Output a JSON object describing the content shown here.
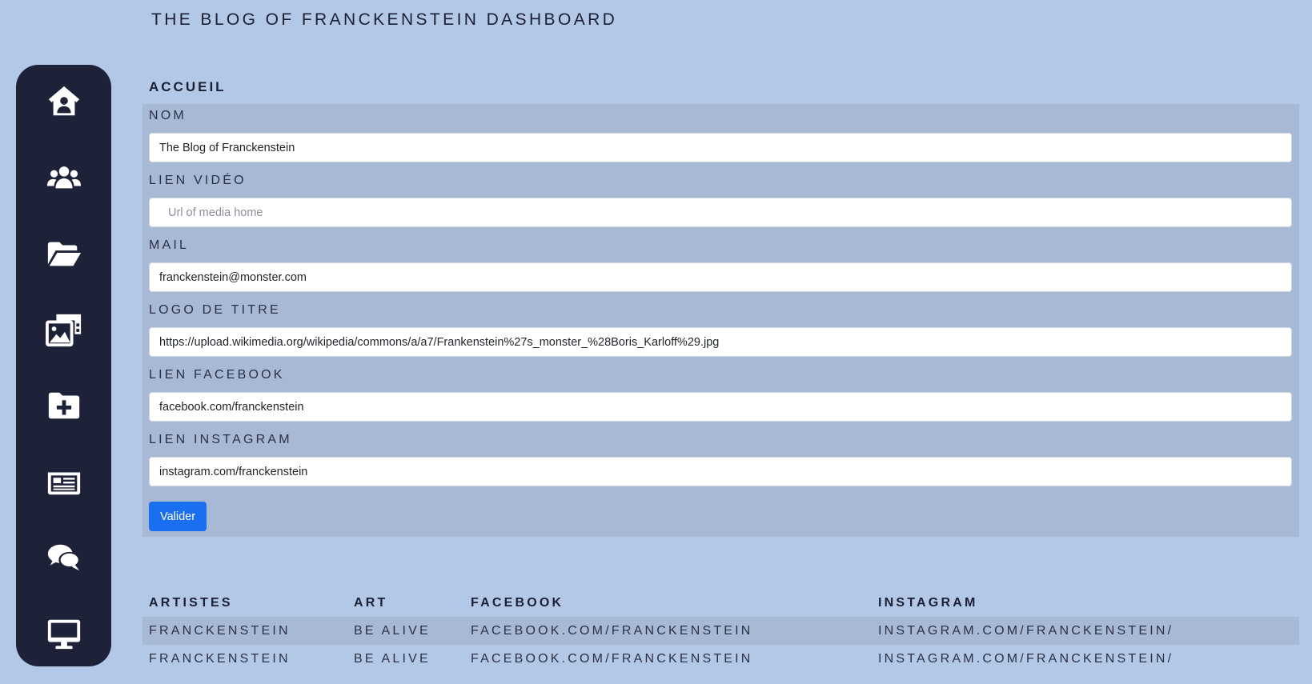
{
  "app": {
    "title": "THE BLOG OF FRANCKENSTEIN DASHBOARD"
  },
  "sidebar": {
    "items": [
      {
        "icon": "home-user-icon"
      },
      {
        "icon": "users-icon"
      },
      {
        "icon": "folder-open-icon"
      },
      {
        "icon": "photo-video-icon"
      },
      {
        "icon": "folder-plus-icon"
      },
      {
        "icon": "newspaper-icon"
      },
      {
        "icon": "comments-icon"
      },
      {
        "icon": "desktop-icon"
      }
    ]
  },
  "form": {
    "section_title": "ACCUEIL",
    "fields": {
      "nom": {
        "label": "NOM",
        "value": "The Blog of Franckenstein",
        "placeholder": ""
      },
      "lien_video": {
        "label": "LIEN VIDÉO",
        "value": "",
        "placeholder": "Url of media home"
      },
      "mail": {
        "label": "MAIL",
        "value": "franckenstein@monster.com",
        "placeholder": ""
      },
      "logo_titre": {
        "label": "LOGO DE TITRE",
        "value": "https://upload.wikimedia.org/wikipedia/commons/a/a7/Frankenstein%27s_monster_%28Boris_Karloff%29.jpg",
        "placeholder": ""
      },
      "lien_facebook": {
        "label": "LIEN FACEBOOK",
        "value": "facebook.com/franckenstein",
        "placeholder": ""
      },
      "lien_instagram": {
        "label": "LIEN INSTAGRAM",
        "value": "instagram.com/franckenstein",
        "placeholder": ""
      }
    },
    "submit_label": "Valider"
  },
  "table": {
    "headers": [
      "ARTISTES",
      "ART",
      "FACEBOOK",
      "INSTAGRAM"
    ],
    "rows": [
      [
        "FRANCKENSTEIN",
        "BE ALIVE",
        "FACEBOOK.COM/FRANCKENSTEIN",
        "INSTAGRAM.COM/FRANCKENSTEIN/"
      ],
      [
        "FRANCKENSTEIN",
        "BE ALIVE",
        "FACEBOOK.COM/FRANCKENSTEIN",
        "INSTAGRAM.COM/FRANCKENSTEIN/"
      ]
    ]
  },
  "colors": {
    "background": "#b3c7e6",
    "sidebar": "#1e2238",
    "panel": "#a8b9d6",
    "accent": "#1a6ff0"
  }
}
